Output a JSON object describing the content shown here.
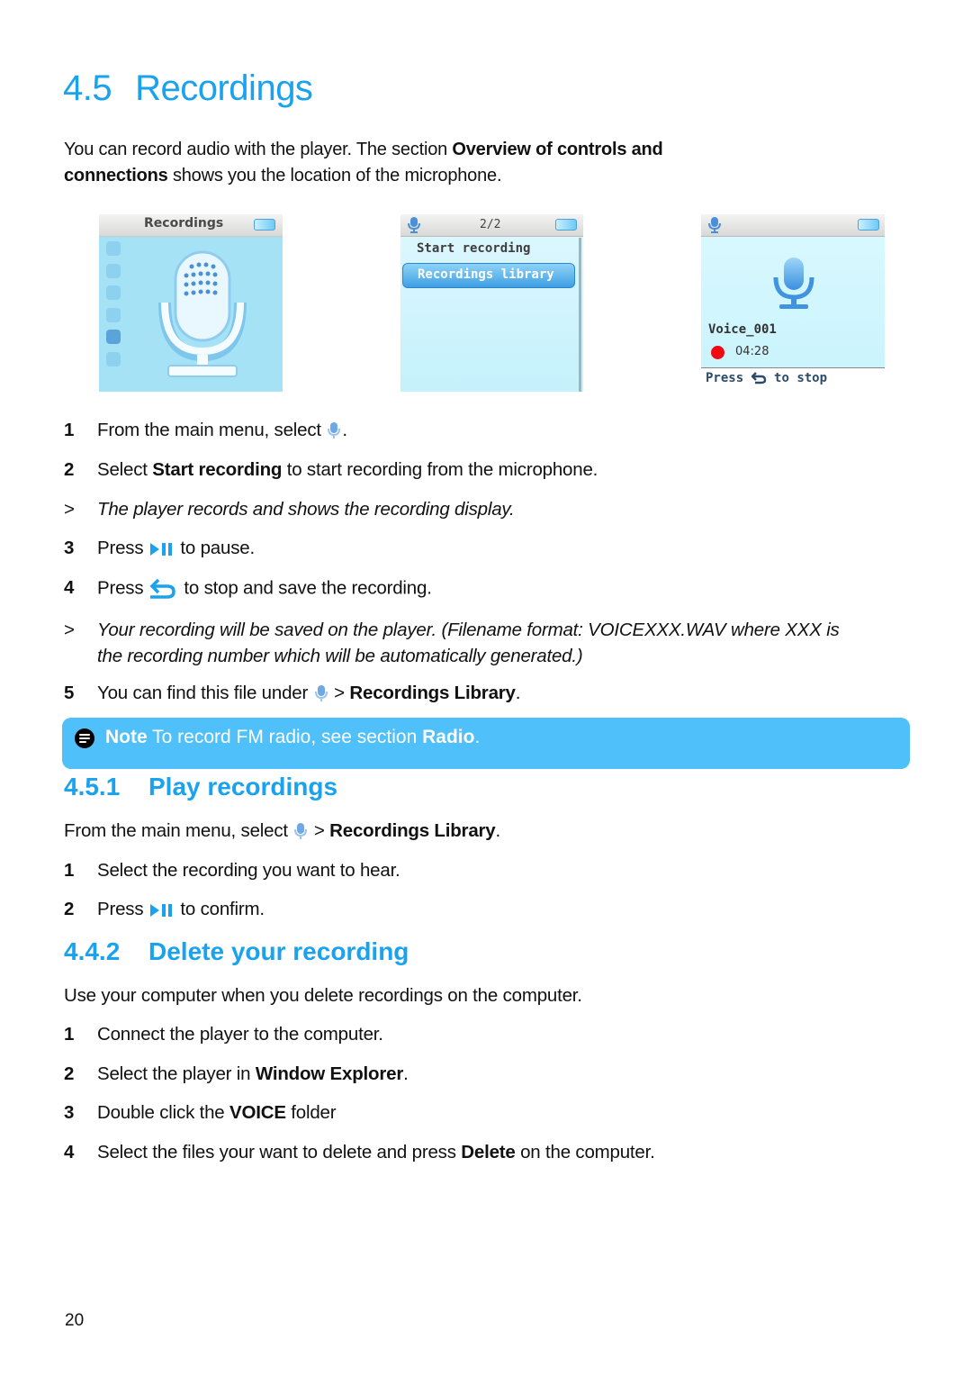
{
  "heading": {
    "number": "4.5",
    "title": "Recordings"
  },
  "intro": {
    "text_1": "You can record audio with the player. The section ",
    "bold_1": "Overview of controls and",
    "bold_2": "connections",
    "text_2": " shows you the location of the microphone."
  },
  "screens": {
    "main_menu": {
      "title": "Recordings",
      "icons": [
        "music-icon",
        "photo-icon",
        "video-icon",
        "radio-icon",
        "microphone-icon",
        "settings-icon"
      ],
      "selected": "microphone-icon"
    },
    "recordings_menu": {
      "page": "2/2",
      "items": [
        "Start recording",
        "Recordings library"
      ],
      "selected_index": 1
    },
    "recording_display": {
      "filename": "Voice_001",
      "elapsed": "04:28",
      "hint_prefix": "Press",
      "hint_suffix": "to stop"
    }
  },
  "steps": [
    {
      "marker": "1",
      "text_a": "From the main menu, select ",
      "text_b": "."
    },
    {
      "marker": "2",
      "text_a": "Select ",
      "bold": "Start recording",
      "text_b": " to start recording from the microphone."
    },
    {
      "marker": ">",
      "text_a": "The player records and shows the recording display."
    },
    {
      "marker": "3",
      "text_a": "Press ",
      "text_b": " to pause."
    },
    {
      "marker": "4",
      "text_a": "Press ",
      "text_b": " to stop and save the recording."
    },
    {
      "marker": ">",
      "line_1": "Your recording will be saved on the player. (Filename format: VOICEXXX.WAV where XXX is",
      "line_2": "the recording number which will be automatically generated.)"
    },
    {
      "marker": "5",
      "text_a": "You can find this file under ",
      "text_b": " > ",
      "bold": "Recordings Library",
      "text_c": "."
    }
  ],
  "note": {
    "label": "Note",
    "text": " To record FM radio, see section ",
    "bold": "Radio",
    "end": "."
  },
  "play": {
    "number": "4.5.1",
    "title": "Play recordings",
    "intro_a": "From the main menu, select ",
    "intro_b": " > ",
    "intro_bold": "Recordings Library",
    "intro_end": ".",
    "steps": [
      {
        "marker": "1",
        "text": "Select the recording you want to hear."
      },
      {
        "marker": "2",
        "text_a": "Press ",
        "text_b": " to confirm."
      }
    ]
  },
  "delete": {
    "number": "4.4.2",
    "title": "Delete your recording",
    "intro": "Use your computer when you delete recordings on the computer.",
    "steps": [
      {
        "marker": "1",
        "text": "Connect the player to the computer."
      },
      {
        "marker": "2",
        "text_a": "Select the player in ",
        "bold": "Window Explorer",
        "text_b": "."
      },
      {
        "marker": "3",
        "text_a": "Double click the ",
        "bold": "VOICE",
        "text_b": " folder"
      },
      {
        "marker": "4",
        "text_a": "Select the files your want to delete and press ",
        "bold": "Delete",
        "text_b": " on the computer."
      }
    ]
  },
  "page_number": "20",
  "colors": {
    "heading": "#1aa2ee",
    "note_bg": "#4fc0fa",
    "record_dot": "#ee0a10"
  }
}
